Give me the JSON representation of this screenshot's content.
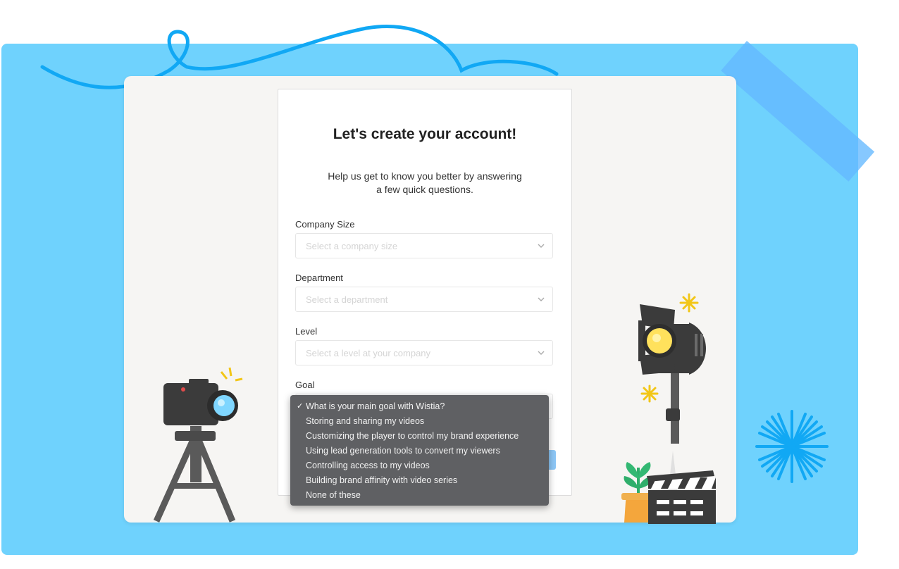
{
  "form": {
    "title": "Let's create your account!",
    "subtitle_line1": "Help us get to know you better by answering",
    "subtitle_line2": "a few quick questions.",
    "fields": [
      {
        "label": "Company Size",
        "placeholder": "Select a company size"
      },
      {
        "label": "Department",
        "placeholder": "Select a department"
      },
      {
        "label": "Level",
        "placeholder": "Select a level at your company"
      },
      {
        "label": "Goal"
      }
    ]
  },
  "goal_dropdown": {
    "selected_index": 0,
    "options": [
      "What is your main goal with Wistia?",
      "Storing and sharing my videos",
      "Customizing the player to control my brand experience",
      "Using lead generation tools to convert my viewers",
      "Controlling access to my videos",
      "Building brand affinity with video series",
      "None of these"
    ]
  },
  "colors": {
    "background_blue": "#6fd2fd",
    "accent_blue": "#10a9f5",
    "dropdown_bg": "#5f6063"
  },
  "icons": [
    "camera-tripod-icon",
    "spotlight-icon",
    "clapperboard-icon",
    "plant-icon",
    "sparkle-icon",
    "starburst-icon",
    "chevron-down-icon",
    "checkmark-icon"
  ]
}
